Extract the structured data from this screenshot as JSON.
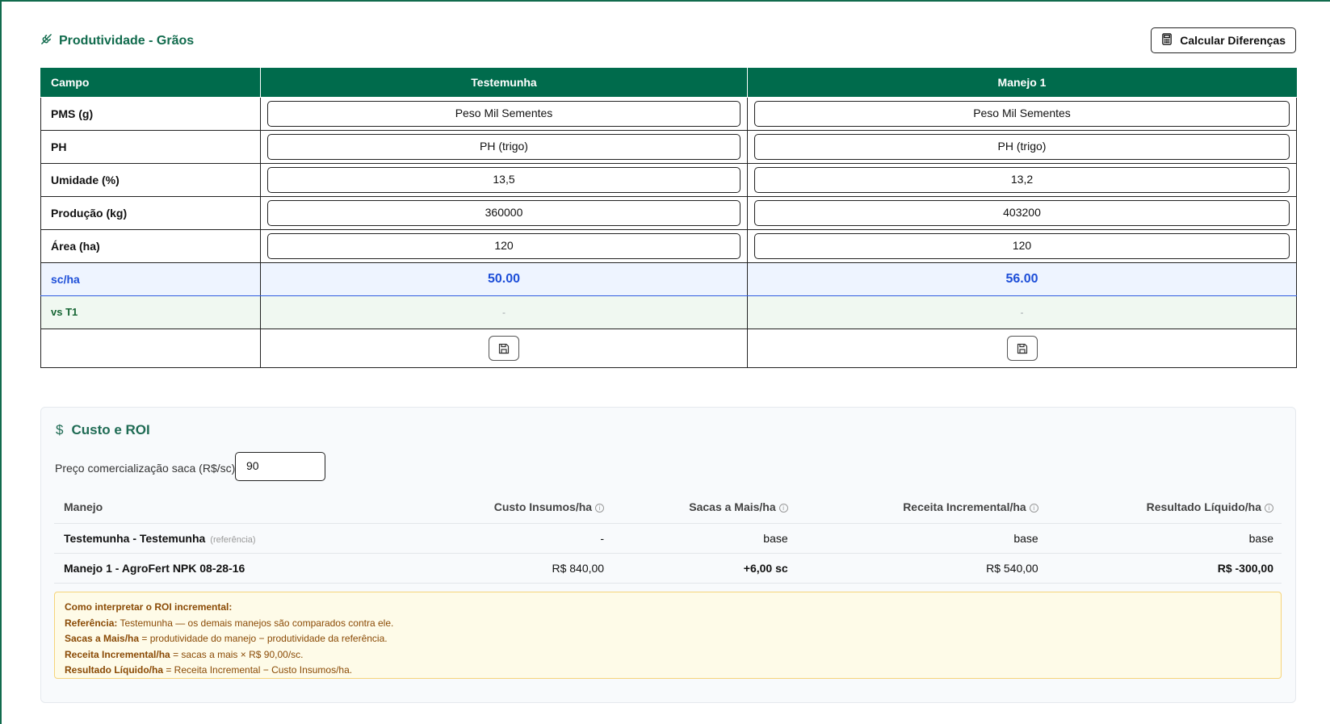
{
  "header": {
    "title": "Produtividade - Grãos",
    "calc_button": "Calcular Diferenças"
  },
  "grid": {
    "columns": [
      "Campo",
      "Testemunha",
      "Manejo 1"
    ],
    "rows": [
      {
        "label": "PMS (g)",
        "values": [
          "Peso Mil Sementes",
          "Peso Mil Sementes"
        ]
      },
      {
        "label": "PH",
        "values": [
          "PH (trigo)",
          "PH (trigo)"
        ]
      },
      {
        "label": "Umidade (%)",
        "values": [
          "13,5",
          "13,2"
        ]
      },
      {
        "label": "Produção (kg)",
        "values": [
          "360000",
          "403200"
        ]
      },
      {
        "label": "Área (ha)",
        "values": [
          "120",
          "120"
        ]
      }
    ],
    "scha": {
      "label": "sc/ha",
      "values": [
        "50.00",
        "56.00"
      ]
    },
    "vs": {
      "label": "vs T1",
      "values": [
        "-",
        "-"
      ]
    }
  },
  "roi": {
    "title": "Custo e ROI",
    "price_label": "Preço comercialização saca (R$/sc)",
    "price_value": "90",
    "columns": [
      "Manejo",
      "Custo Insumos/ha",
      "Sacas a Mais/ha",
      "Receita Incremental/ha",
      "Resultado Líquido/ha"
    ],
    "rows": [
      {
        "name": "Testemunha - Testemunha",
        "tag": "(referência)",
        "custo": "-",
        "sacas": "base",
        "receita": "base",
        "resultado": "base"
      },
      {
        "name": "Manejo 1 - AgroFert NPK 08-28-16",
        "tag": "",
        "custo": "R$ 840,00",
        "sacas": "+6,00 sc",
        "receita": "R$ 540,00",
        "resultado": "R$ -300,00"
      }
    ],
    "note": {
      "heading": "Como interpretar o ROI incremental:",
      "lines": [
        {
          "key": "Referência:",
          "text": " Testemunha — os demais manejos são comparados contra ele."
        },
        {
          "key": "Sacas a Mais/ha",
          "text": " = produtividade do manejo − produtividade da referência."
        },
        {
          "key": "Receita Incremental/ha",
          "text": " = sacas a mais × R$ 90,00/sc."
        },
        {
          "key": "Resultado Líquido/ha",
          "text": " = Receita Incremental − Custo Insumos/ha."
        }
      ]
    }
  },
  "colors": {
    "brand": "#006b4c",
    "blue": "#1d4ed8",
    "red": "#dc2626",
    "green": "#15803d"
  }
}
